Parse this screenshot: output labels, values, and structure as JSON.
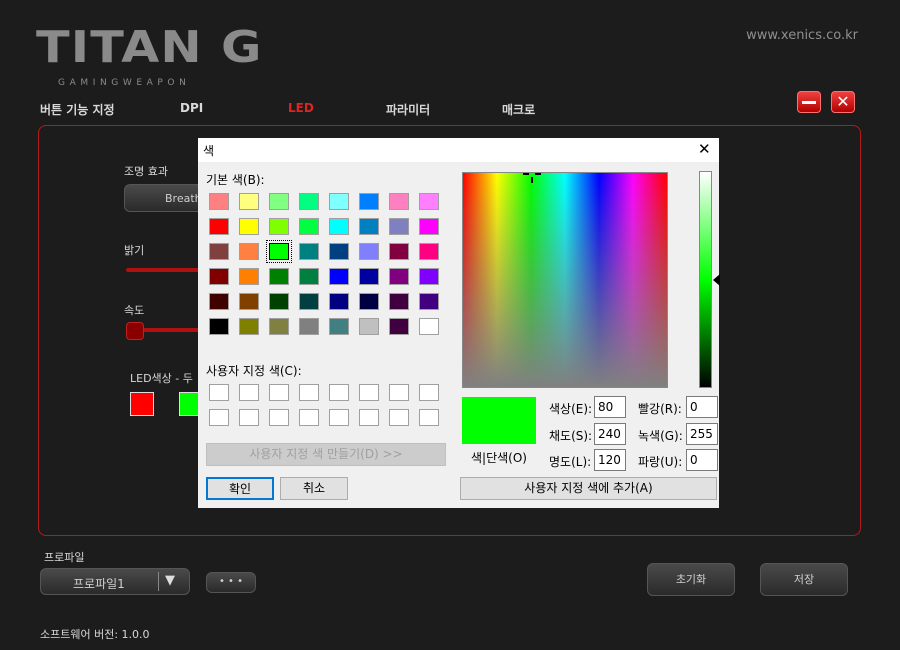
{
  "app": {
    "logo_main": "TITAN G",
    "logo_sub": "GAMINGWEAPON",
    "website": "www.xenics.co.kr",
    "minimize_icon": "minus",
    "close_icon": "x"
  },
  "tabs": [
    {
      "label": "버튼 기능 지정",
      "active": false
    },
    {
      "label": "DPI",
      "active": false
    },
    {
      "label": "LED",
      "active": true
    },
    {
      "label": "파라미터",
      "active": false
    },
    {
      "label": "매크로",
      "active": false
    }
  ],
  "led": {
    "effect_label": "조명 효과",
    "effect_value": "Breathe",
    "brightness_label": "밝기",
    "speed_label": "속도",
    "color_label": "LED색상 - 두",
    "color1": "#ff0000",
    "color2": "#00ff00"
  },
  "profile": {
    "label": "프로파일",
    "value": "프로파일1",
    "more_label": "• • •",
    "reset_label": "초기화",
    "save_label": "저장"
  },
  "version": "소프트웨어 버전: 1.0.0",
  "dialog": {
    "title": "색",
    "basic_colors_label": "기본 색(B):",
    "custom_colors_label": "사용자 지정 색(C):",
    "define_custom_label": "사용자 지정 색 만들기(D) >>",
    "ok_label": "확인",
    "cancel_label": "취소",
    "preview_label": "색|단색(O)",
    "add_custom_label": "사용자 지정 색에 추가(A)",
    "hue_label": "색상(E):",
    "hue_value": "80",
    "sat_label": "채도(S):",
    "sat_value": "240",
    "lum_label": "명도(L):",
    "lum_value": "120",
    "red_label": "빨강(R):",
    "red_value": "0",
    "green_label": "녹색(G):",
    "green_value": "255",
    "blue_label": "파랑(U):",
    "blue_value": "0",
    "current_color": "#00ff00",
    "basic_colors": [
      "#ff8080",
      "#ffff80",
      "#80ff80",
      "#00ff80",
      "#80ffff",
      "#0080ff",
      "#ff80c0",
      "#ff80ff",
      "#ff0000",
      "#ffff00",
      "#80ff00",
      "#00ff40",
      "#00ffff",
      "#0080c0",
      "#8080c0",
      "#ff00ff",
      "#804040",
      "#ff8040",
      "#00ff00",
      "#008080",
      "#004080",
      "#8080ff",
      "#800040",
      "#ff0080",
      "#800000",
      "#ff8000",
      "#008000",
      "#008040",
      "#0000ff",
      "#0000a0",
      "#800080",
      "#8000ff",
      "#400000",
      "#804000",
      "#004000",
      "#004040",
      "#000080",
      "#000040",
      "#400040",
      "#400080",
      "#000000",
      "#808000",
      "#808040",
      "#808080",
      "#408080",
      "#c0c0c0",
      "#400040",
      "#ffffff"
    ],
    "selected_index": 18
  }
}
